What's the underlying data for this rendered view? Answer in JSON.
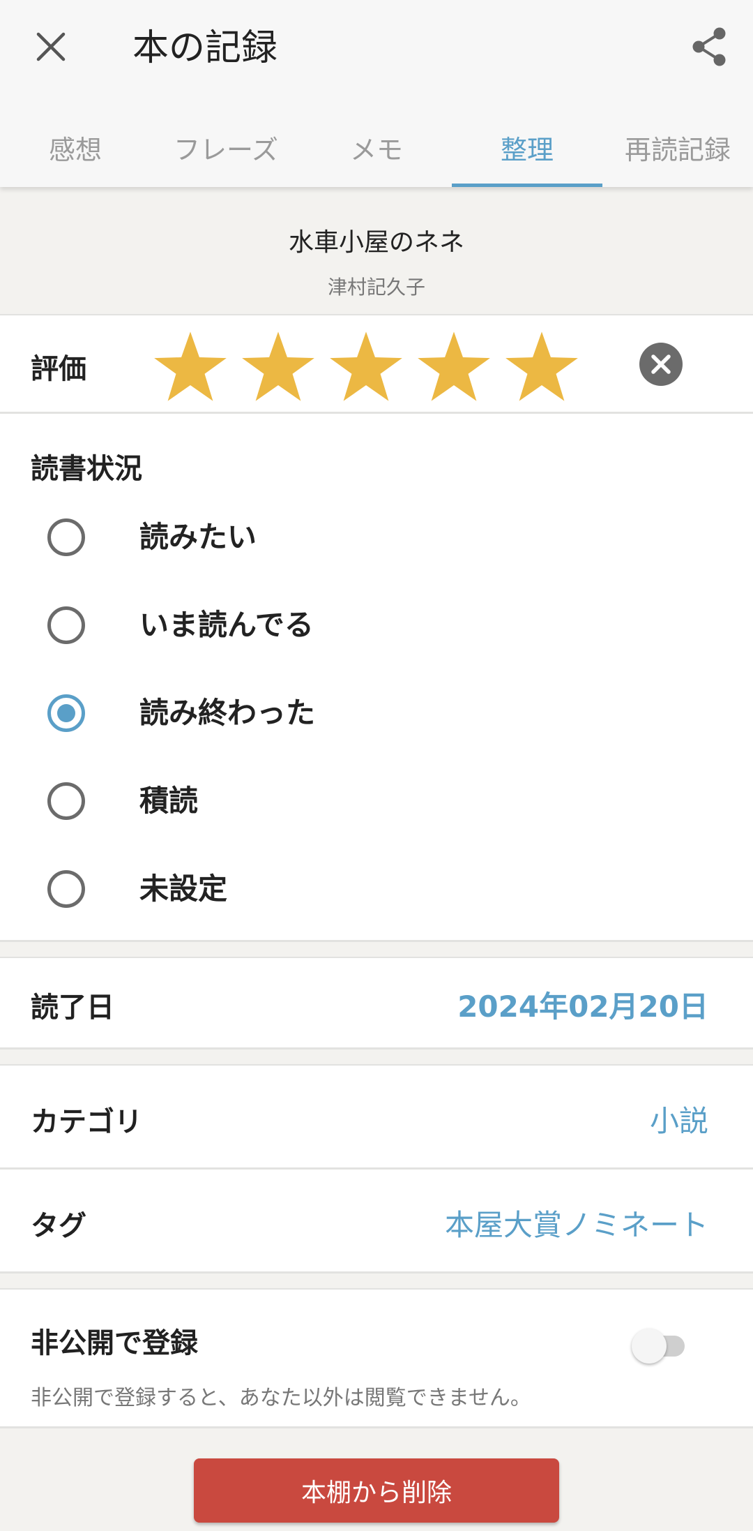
{
  "header": {
    "title": "本の記録"
  },
  "tabs": [
    {
      "label": "感想",
      "active": false
    },
    {
      "label": "フレーズ",
      "active": false
    },
    {
      "label": "メモ",
      "active": false
    },
    {
      "label": "整理",
      "active": true
    },
    {
      "label": "再読記録",
      "active": false
    }
  ],
  "book": {
    "title": "水車小屋のネネ",
    "author": "津村記久子"
  },
  "rating": {
    "label": "評価",
    "value": 5,
    "max": 5
  },
  "reading_status": {
    "heading": "読書状況",
    "options": [
      {
        "label": "読みたい",
        "selected": false
      },
      {
        "label": "いま読んでる",
        "selected": false
      },
      {
        "label": "読み終わった",
        "selected": true
      },
      {
        "label": "積読",
        "selected": false
      },
      {
        "label": "未設定",
        "selected": false
      }
    ]
  },
  "finish_date": {
    "label": "読了日",
    "value": "2024年02月20日"
  },
  "category": {
    "label": "カテゴリ",
    "value": "小説"
  },
  "tag": {
    "label": "タグ",
    "value": "本屋大賞ノミネート"
  },
  "private": {
    "label": "非公開で登録",
    "enabled": false,
    "note": "非公開で登録すると、あなた以外は閲覧できません。"
  },
  "delete_button": {
    "label": "本棚から削除"
  },
  "colors": {
    "accent": "#5a9fc8",
    "star": "#ecb843",
    "danger": "#c9493f"
  }
}
